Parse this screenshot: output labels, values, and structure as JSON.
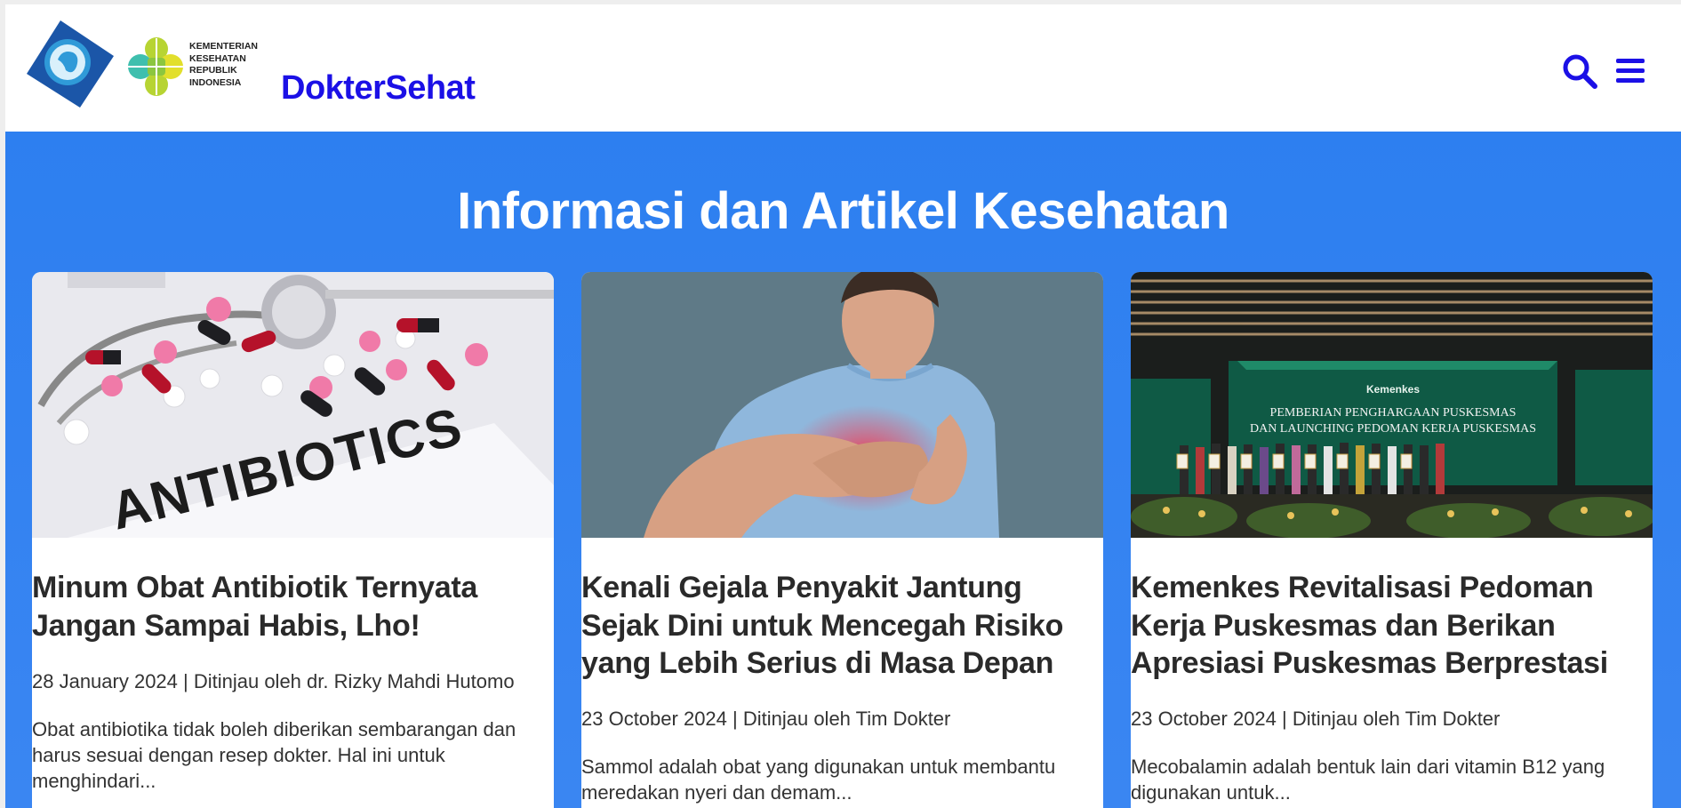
{
  "header": {
    "kemenkes_lines": [
      "KEMENTERIAN",
      "KESEHATAN",
      "REPUBLIK",
      "INDONESIA"
    ],
    "brand": "DokterSehat",
    "icons": [
      "search-icon",
      "menu-icon"
    ],
    "brand_color": "#1b10e6"
  },
  "main": {
    "section_title": "Informasi dan Artikel Kesehatan",
    "background_color": "#2d7ff0",
    "articles": [
      {
        "title": "Minum Obat Antibiotik Ternyata Jangan Sampai Habis, Lho!",
        "meta": "28 January 2024 | Ditinjau oleh dr. Rizky Mahdi Hutomo",
        "excerpt": "Obat antibiotika tidak boleh diberikan sembarangan dan harus sesuai dengan resep dokter. Hal ini untuk menghindari...",
        "image_text": "ANTIBIOTICS"
      },
      {
        "title": "Kenali Gejala Penyakit Jantung Sejak Dini untuk Mencegah Risiko yang Lebih Serius di Masa Depan",
        "meta": "23 October 2024 | Ditinjau oleh Tim Dokter",
        "excerpt": "Sammol adalah obat yang digunakan untuk membantu meredakan nyeri dan demam..."
      },
      {
        "title": "Kemenkes Revitalisasi Pedoman Kerja Puskesmas dan Berikan Apresiasi Puskesmas Berprestasi",
        "meta": "23 October 2024 | Ditinjau oleh Tim Dokter",
        "excerpt": "Mecobalamin adalah bentuk lain dari vitamin B12 yang digunakan untuk...",
        "image_text": {
          "brand": "Kemenkes",
          "line1": "PEMBERIAN PENGHARGAAN PUSKESMAS",
          "line2": "DAN LAUNCHING PEDOMAN KERJA PUSKESMAS"
        }
      }
    ]
  }
}
